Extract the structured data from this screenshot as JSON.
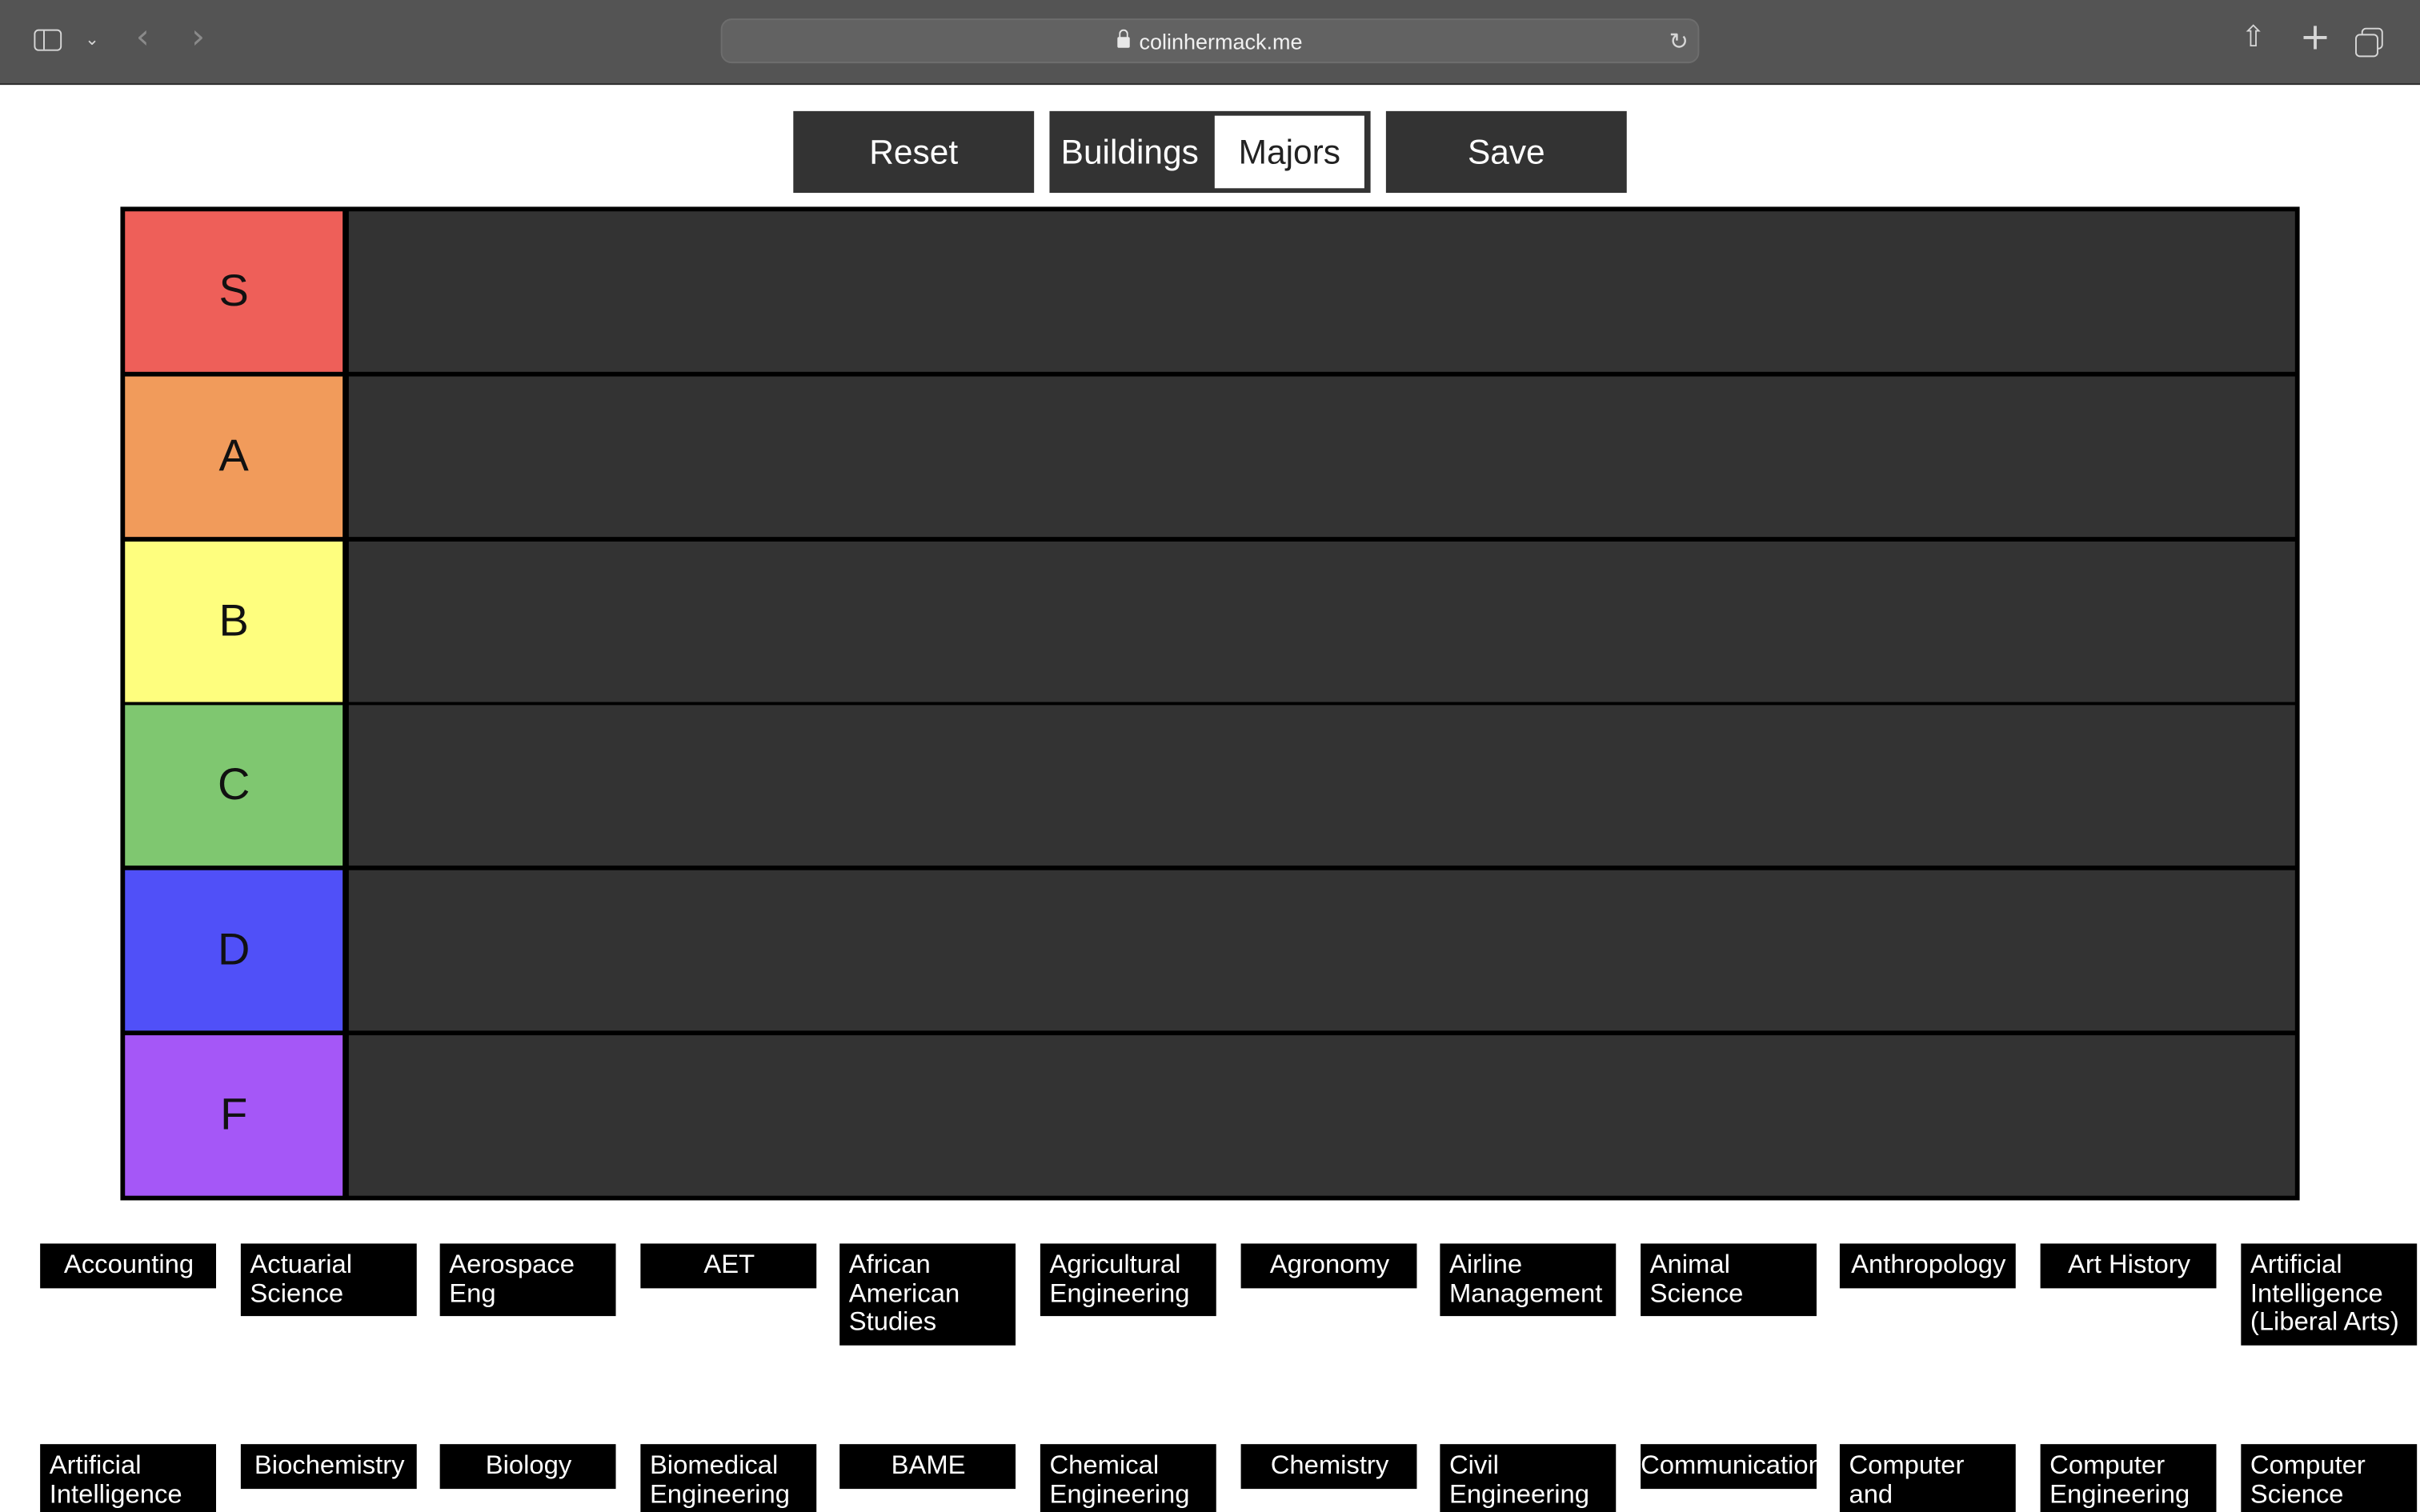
{
  "browser": {
    "url": "colinhermack.me",
    "icons": {
      "sidebar": "sidebar-icon",
      "tab_overview_chevron": "chevron-down-icon",
      "back": "back-arrow-icon",
      "forward": "forward-arrow-icon",
      "lock": "lock-icon",
      "reload": "reload-icon",
      "share": "share-icon",
      "new_tab": "plus-icon",
      "tabs": "tabs-overview-icon"
    }
  },
  "controls": {
    "reset_label": "Reset",
    "buildings_label": "Buildings",
    "majors_label": "Majors",
    "save_label": "Save",
    "selected_mode": "Majors"
  },
  "tiers": [
    {
      "label": "S",
      "color": "#ee5f59"
    },
    {
      "label": "A",
      "color": "#f19b5b"
    },
    {
      "label": "B",
      "color": "#fefe7e"
    },
    {
      "label": "C",
      "color": "#7fc770"
    },
    {
      "label": "D",
      "color": "#5050f8"
    },
    {
      "label": "F",
      "color": "#a557f7"
    }
  ],
  "items": [
    "Accounting",
    "Actuarial Science",
    "Aerospace Eng",
    "AET",
    "African American Studies",
    "Agricultural Engineering",
    "Agronomy",
    "Airline Management",
    "Animal Science",
    "Anthropology",
    "Art History",
    "Artificial Intelligence (Liberal Arts)",
    "Artificial Intelligence",
    "Biochemistry",
    "Biology",
    "Biomedical Engineering",
    "BAME",
    "Chemical Engineering",
    "Chemistry",
    "Civil Engineering",
    "Communication",
    "Computer and",
    "Computer Engineering",
    "Computer Science"
  ]
}
